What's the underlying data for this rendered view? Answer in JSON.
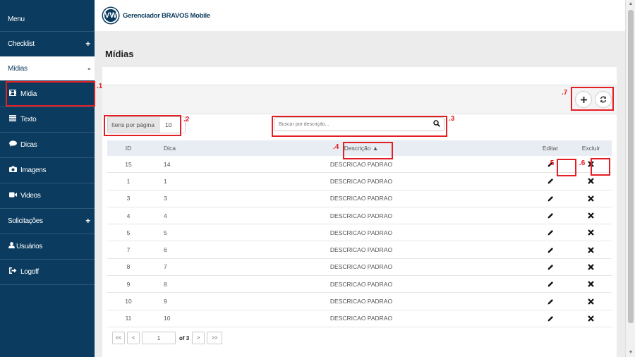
{
  "sidebar": {
    "header": "Menu",
    "items": [
      {
        "label": "Checklist",
        "toggle": "+"
      },
      {
        "label": "Mídias",
        "toggle": "-"
      },
      {
        "label": "Mídia",
        "icon": "film-icon"
      },
      {
        "label": "Texto",
        "icon": "list-icon"
      },
      {
        "label": "Dicas",
        "icon": "comment-icon"
      },
      {
        "label": "Imagens",
        "icon": "camera-icon"
      },
      {
        "label": "Videos",
        "icon": "video-icon"
      },
      {
        "label": "Solicitações",
        "toggle": "+"
      },
      {
        "label": "Usuários",
        "icon": "user-icon"
      },
      {
        "label": "Logoff",
        "icon": "logout-icon"
      }
    ]
  },
  "topbar": {
    "title": "Gerenciador BRAVOS Mobile",
    "logo": "VW"
  },
  "page": {
    "title": "Mídias"
  },
  "controls": {
    "per_page_label": "Itens por página",
    "per_page_value": "10",
    "search_placeholder": "Buscar por descrição..."
  },
  "table": {
    "headers": {
      "id": "ID",
      "dica": "Dica",
      "descricao": "Descrição ▲",
      "editar": "Editar",
      "excluir": "Excluir"
    },
    "rows": [
      {
        "id": "15",
        "dica": "14",
        "desc": "DESCRICAO PADRAO"
      },
      {
        "id": "1",
        "dica": "1",
        "desc": "DESCRICAO PADRAO"
      },
      {
        "id": "3",
        "dica": "3",
        "desc": "DESCRICAO PADRAO"
      },
      {
        "id": "4",
        "dica": "4",
        "desc": "DESCRICAO PADRAO"
      },
      {
        "id": "5",
        "dica": "5",
        "desc": "DESCRICAO PADRAO"
      },
      {
        "id": "7",
        "dica": "6",
        "desc": "DESCRICAO PADRAO"
      },
      {
        "id": "8",
        "dica": "7",
        "desc": "DESCRICAO PADRAO"
      },
      {
        "id": "9",
        "dica": "8",
        "desc": "DESCRICAO PADRAO"
      },
      {
        "id": "10",
        "dica": "9",
        "desc": "DESCRICAO PADRAO"
      },
      {
        "id": "11",
        "dica": "10",
        "desc": "DESCRICAO PADRAO"
      }
    ]
  },
  "pager": {
    "first": "<<",
    "prev": "<",
    "current": "1",
    "of": "of 3",
    "next": ">",
    "last": ">>"
  },
  "annotations": [
    ".1",
    ".2",
    ".3",
    ".4",
    ".5",
    ".6",
    ".7"
  ],
  "colors": {
    "sidebar": "#0b3b5e",
    "highlight": "#e31e24",
    "content_bg": "#ececec"
  }
}
